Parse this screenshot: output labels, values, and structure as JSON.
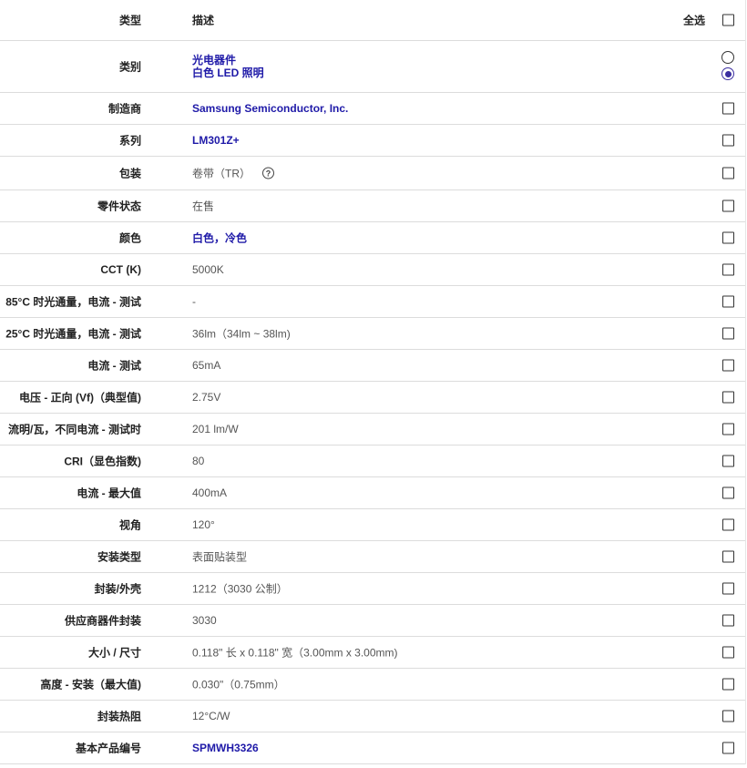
{
  "header": {
    "type_label": "类型",
    "desc_label": "描述",
    "select_all_label": "全选"
  },
  "category": {
    "label": "类别",
    "values": [
      "光电器件",
      "白色 LED 照明"
    ]
  },
  "rows": [
    {
      "label": "制造商",
      "value": "Samsung Semiconductor, Inc.",
      "link": true
    },
    {
      "label": "系列",
      "value": "LM301Z+",
      "link": true
    },
    {
      "label": "包装",
      "value": "卷带（TR）",
      "link": false,
      "help": "?"
    },
    {
      "label": "零件状态",
      "value": "在售",
      "link": false
    },
    {
      "label": "颜色",
      "value": "白色，冷色",
      "link": true
    },
    {
      "label": "CCT (K)",
      "value": "5000K",
      "link": false
    },
    {
      "label": "85°C 时光通量，电流 - 测试",
      "value": "-",
      "link": false
    },
    {
      "label": "25°C 时光通量，电流 - 测试",
      "value": "36lm（34lm ~ 38lm)",
      "link": false
    },
    {
      "label": "电流 - 测试",
      "value": "65mA",
      "link": false
    },
    {
      "label": "电压 - 正向 (Vf)（典型值)",
      "value": "2.75V",
      "link": false
    },
    {
      "label": "流明/瓦，不同电流 - 测试时",
      "value": "201 lm/W",
      "link": false
    },
    {
      "label": "CRI（显色指数)",
      "value": "80",
      "link": false
    },
    {
      "label": "电流 - 最大值",
      "value": "400mA",
      "link": false
    },
    {
      "label": "视角",
      "value": "120°",
      "link": false
    },
    {
      "label": "安装类型",
      "value": "表面贴装型",
      "link": false
    },
    {
      "label": "封装/外壳",
      "value": "1212（3030 公制）",
      "link": false
    },
    {
      "label": "供应商器件封装",
      "value": "3030",
      "link": false
    },
    {
      "label": "大小 / 尺寸",
      "value": "0.118\" 长 x 0.118\" 宽（3.00mm x 3.00mm)",
      "link": false
    },
    {
      "label": "高度 - 安装（最大值)",
      "value": "0.030\"（0.75mm）",
      "link": false
    },
    {
      "label": "封装热阻",
      "value": "12°C/W",
      "link": false
    },
    {
      "label": "基本产品编号",
      "value": "SPMWH3326",
      "link": true
    }
  ]
}
